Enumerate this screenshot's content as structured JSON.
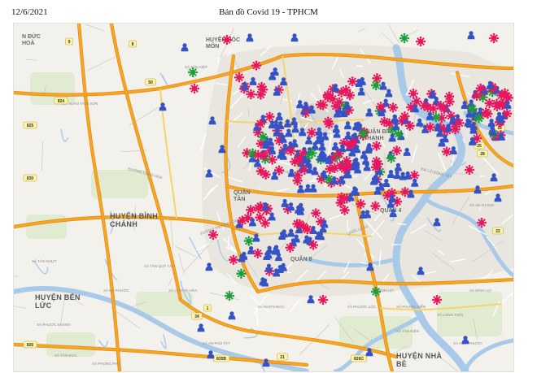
{
  "header": {
    "date": "12/6/2021",
    "title": "Bản đồ Covid 19 - TPHCM"
  },
  "colors": {
    "water": "#a9c9e8",
    "park": "#d7e8c6",
    "urban": "#e9e6df",
    "road_major": "#f6a623",
    "road_minor": "#ffffff",
    "marker_person": "#3653c6",
    "marker_virus_red": "#e8175d",
    "marker_virus_green": "#1e9e3a"
  },
  "map": {
    "district_labels": [
      {
        "text": "HUYỆN HÓC MÔN",
        "lines": [
          "HUYỆN HÓC",
          "MÔN"
        ],
        "size": "mid"
      },
      {
        "text": "HUYỆN BÌNH CHÁNH",
        "lines": [
          "HUYỆN BÌNH",
          "CHÁNH"
        ],
        "size": "big"
      },
      {
        "text": "HUYỆN BẾN LỨC",
        "lines": [
          "HUYỆN BẾN",
          "LỨC"
        ],
        "size": "big"
      },
      {
        "text": "HUYỆN NHÀ BÈ",
        "lines": [
          "HUYỆN NHÀ",
          "BÈ"
        ],
        "size": "big"
      },
      {
        "text": "HUYỆN ĐỨC HÒA",
        "lines": [
          "N ĐỨC",
          "HOÀ"
        ],
        "size": "mid"
      },
      {
        "text": "QUẬN TÂN BÌNH",
        "lines": [
          "QUẬN",
          "TÂN"
        ],
        "size": "mid"
      },
      {
        "text": "QUẬN BÌNH THẠNH",
        "lines": [
          "QUẬN BÌNH",
          "THẠNH"
        ],
        "size": "mid"
      },
      {
        "text": "QUẬN 4",
        "lines": [
          "QUẬN 4"
        ],
        "size": "mid"
      },
      {
        "text": "QUẬN 8",
        "lines": [
          "QUẬN 8"
        ],
        "size": "mid"
      }
    ],
    "place_labels": [
      "Cầu Rạch",
      "XÃ TÂN NHỰT",
      "XÃ ĐA PHƯỚC",
      "XÃ PHONG PHÚ",
      "XÃ AN PHÚ TÂY",
      "XÃ HƯNG LONG",
      "XÃ TÂN QUÝ TÂY",
      "XÃ LƯƠNG HÒA",
      "XÃ TÂN KIÊN",
      "XÃ BÌNH LỢI",
      "XÃ PHƯỚC KIỂN",
      "XÃ PHƯỚC LỘC",
      "XÃ NHƠN ĐỨC",
      "XÃ LONG THỚI",
      "XÃ HIỆP PHƯỚC",
      "XÃ TÂN HIỆP",
      "XÃ XUÂN THỚI SƠN",
      "XÃ BÌNH LỢI",
      "XÃ AN THẠNH",
      "XÃ PHƯỚC KHÁNH",
      "XÃ TÂN ĐỨC"
    ],
    "route_shields": [
      "9",
      "8",
      "824",
      "825",
      "830",
      "826",
      "826C",
      "835B",
      "50",
      "1",
      "22",
      "18",
      "25",
      "28",
      "21",
      "34"
    ]
  }
}
